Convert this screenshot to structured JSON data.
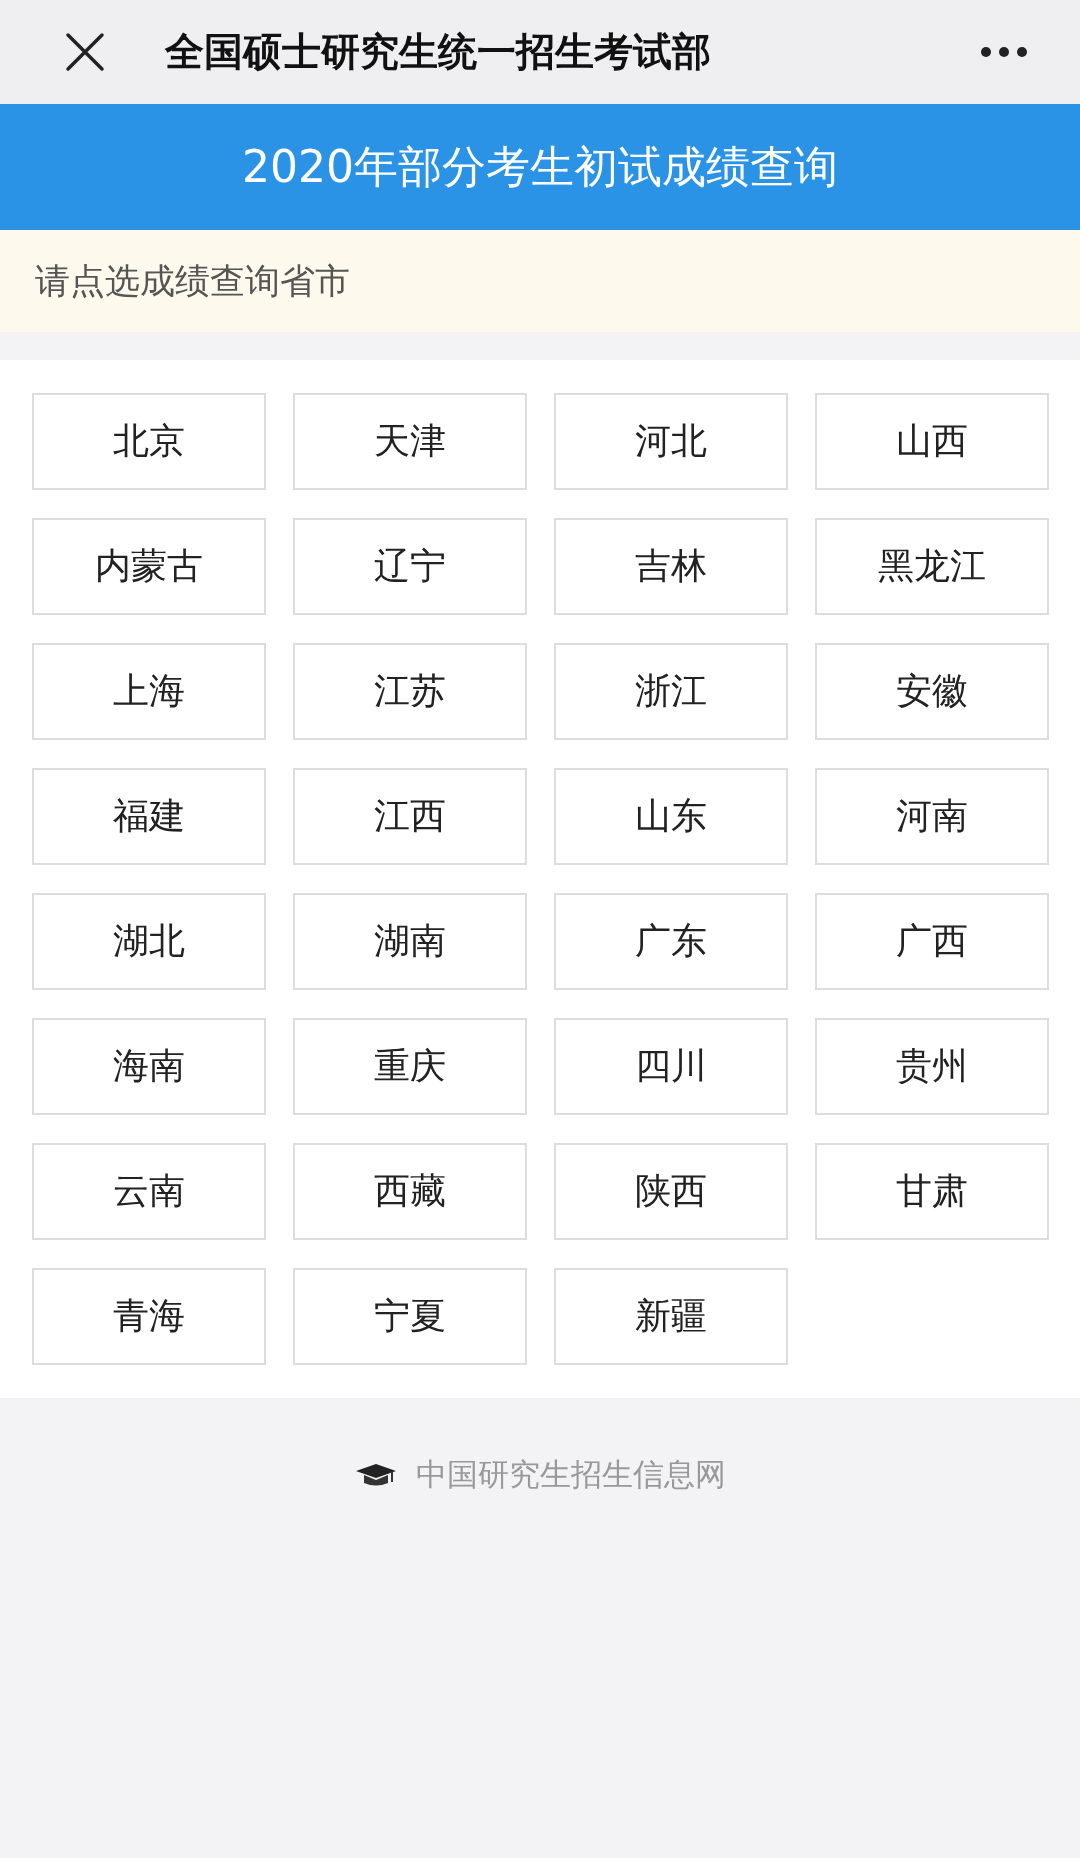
{
  "top_bar": {
    "title": "全国硕士研究生统一招生考试部"
  },
  "banner": {
    "title": "2020年部分考生初试成绩查询"
  },
  "notice": {
    "text": "请点选成绩查询省市"
  },
  "provinces": [
    "北京",
    "天津",
    "河北",
    "山西",
    "内蒙古",
    "辽宁",
    "吉林",
    "黑龙江",
    "上海",
    "江苏",
    "浙江",
    "安徽",
    "福建",
    "江西",
    "山东",
    "河南",
    "湖北",
    "湖南",
    "广东",
    "广西",
    "海南",
    "重庆",
    "四川",
    "贵州",
    "云南",
    "西藏",
    "陕西",
    "甘肃",
    "青海",
    "宁夏",
    "新疆"
  ],
  "footer": {
    "text": "中国研究生招生信息网"
  }
}
